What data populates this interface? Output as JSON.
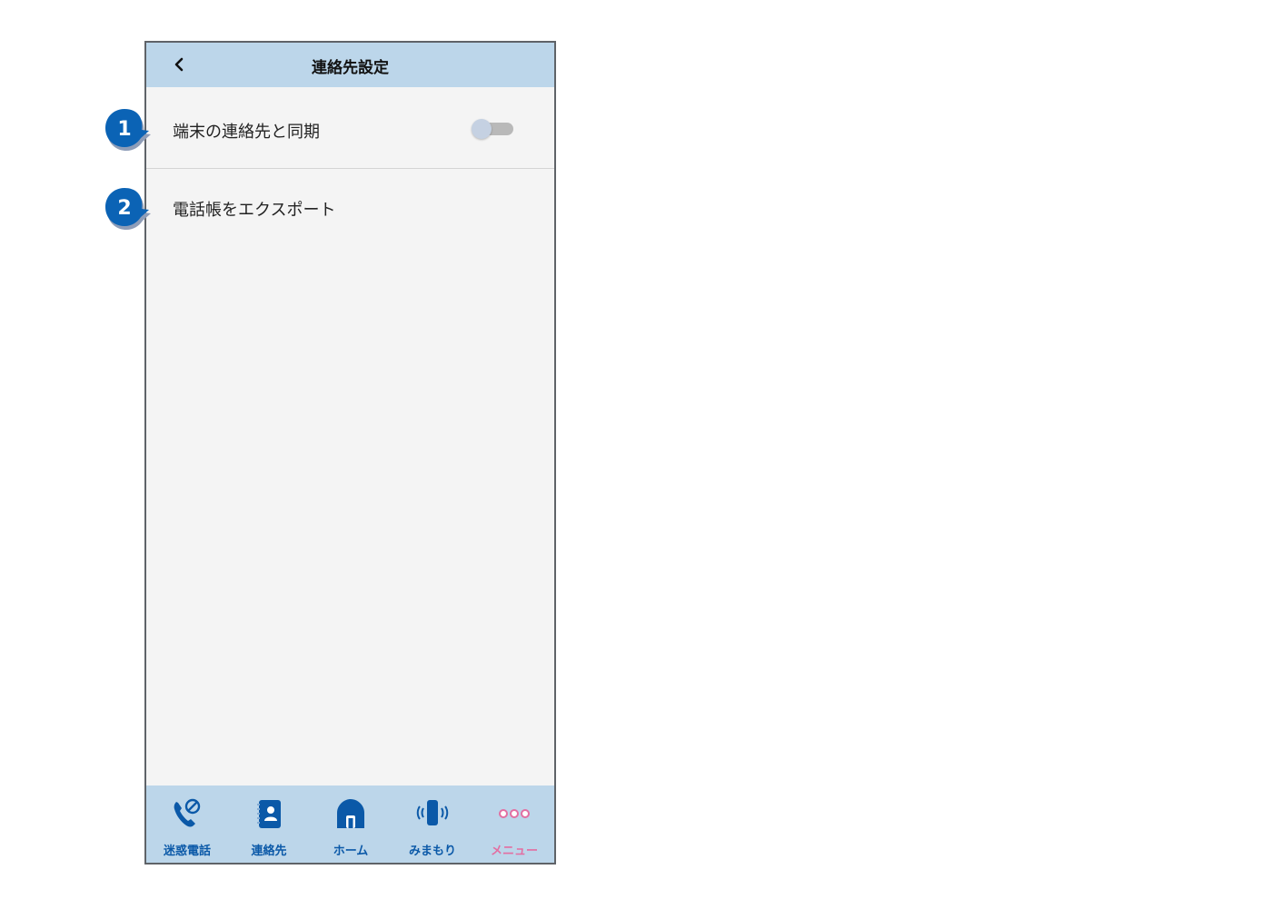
{
  "header": {
    "title": "連絡先設定",
    "back_icon": "chevron-left-icon"
  },
  "settings": [
    {
      "label": "端末の連絡先と同期",
      "badge": "1",
      "control": "toggle",
      "toggle_on": false
    },
    {
      "label": "電話帳をエクスポート",
      "badge": "2"
    }
  ],
  "tabbar": {
    "items": [
      {
        "label": "迷惑電話",
        "icon": "blocked-call-icon"
      },
      {
        "label": "連絡先",
        "icon": "contacts-book-icon"
      },
      {
        "label": "ホーム",
        "icon": "home-icon"
      },
      {
        "label": "みまもり",
        "icon": "vibrating-phone-icon"
      },
      {
        "label": "メニュー",
        "icon": "more-dots-icon",
        "active": true
      }
    ]
  },
  "colors": {
    "header_bg": "#bcd6ea",
    "badge_blue": "#0b63b5",
    "tab_blue": "#0b59a8",
    "menu_pink": "#e36fa2",
    "content_bg": "#f4f4f4"
  }
}
